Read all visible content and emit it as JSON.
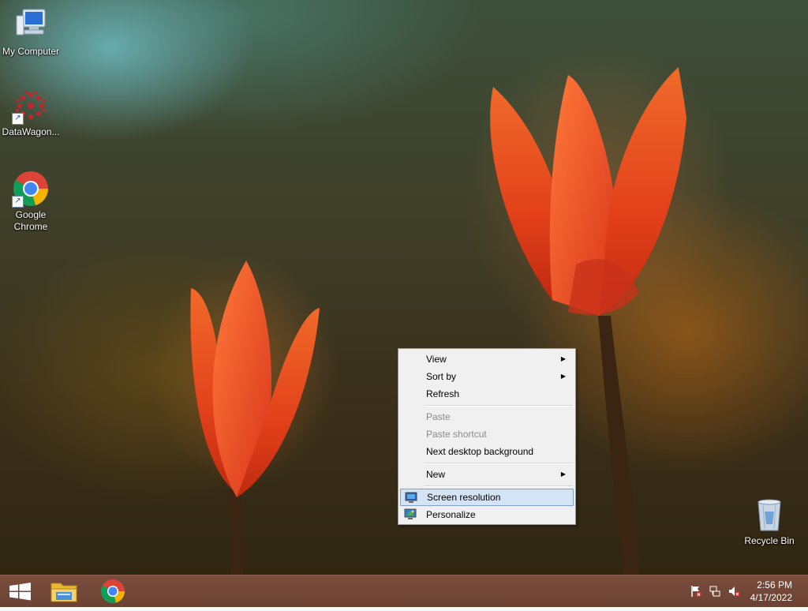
{
  "desktop": {
    "icons": [
      {
        "label": "My Computer",
        "icon": "computer-icon"
      },
      {
        "label": "DataWagon...",
        "icon": "datawagon-icon"
      },
      {
        "label": "Google Chrome",
        "icon": "chrome-icon"
      },
      {
        "label": "Recycle Bin",
        "icon": "recycle-bin-icon"
      }
    ]
  },
  "context_menu": {
    "items": [
      {
        "label": "View",
        "submenu": true,
        "enabled": true
      },
      {
        "label": "Sort by",
        "submenu": true,
        "enabled": true
      },
      {
        "label": "Refresh",
        "enabled": true
      },
      {
        "label": "Paste",
        "enabled": false
      },
      {
        "label": "Paste shortcut",
        "enabled": false
      },
      {
        "label": "Next desktop background",
        "enabled": true
      },
      {
        "label": "New",
        "submenu": true,
        "enabled": true
      },
      {
        "label": "Screen resolution",
        "enabled": true,
        "highlighted": true,
        "icon": "display-icon"
      },
      {
        "label": "Personalize",
        "enabled": true,
        "icon": "personalize-icon"
      }
    ],
    "submenu_arrow": "▶"
  },
  "taskbar": {
    "pinned": [
      {
        "icon": "windows-start-icon"
      },
      {
        "icon": "file-explorer-icon"
      },
      {
        "icon": "chrome-icon"
      }
    ],
    "tray": [
      {
        "icon": "action-center-flag-icon"
      },
      {
        "icon": "network-icon"
      },
      {
        "icon": "volume-muted-icon"
      }
    ],
    "clock": {
      "time": "2:56 PM",
      "date": "4/17/2022"
    }
  },
  "colors": {
    "taskbar": "#6f4536",
    "menu_bg": "#f0f0f0",
    "menu_highlight": "#d5e4f5",
    "tulip": "#e84a18"
  }
}
